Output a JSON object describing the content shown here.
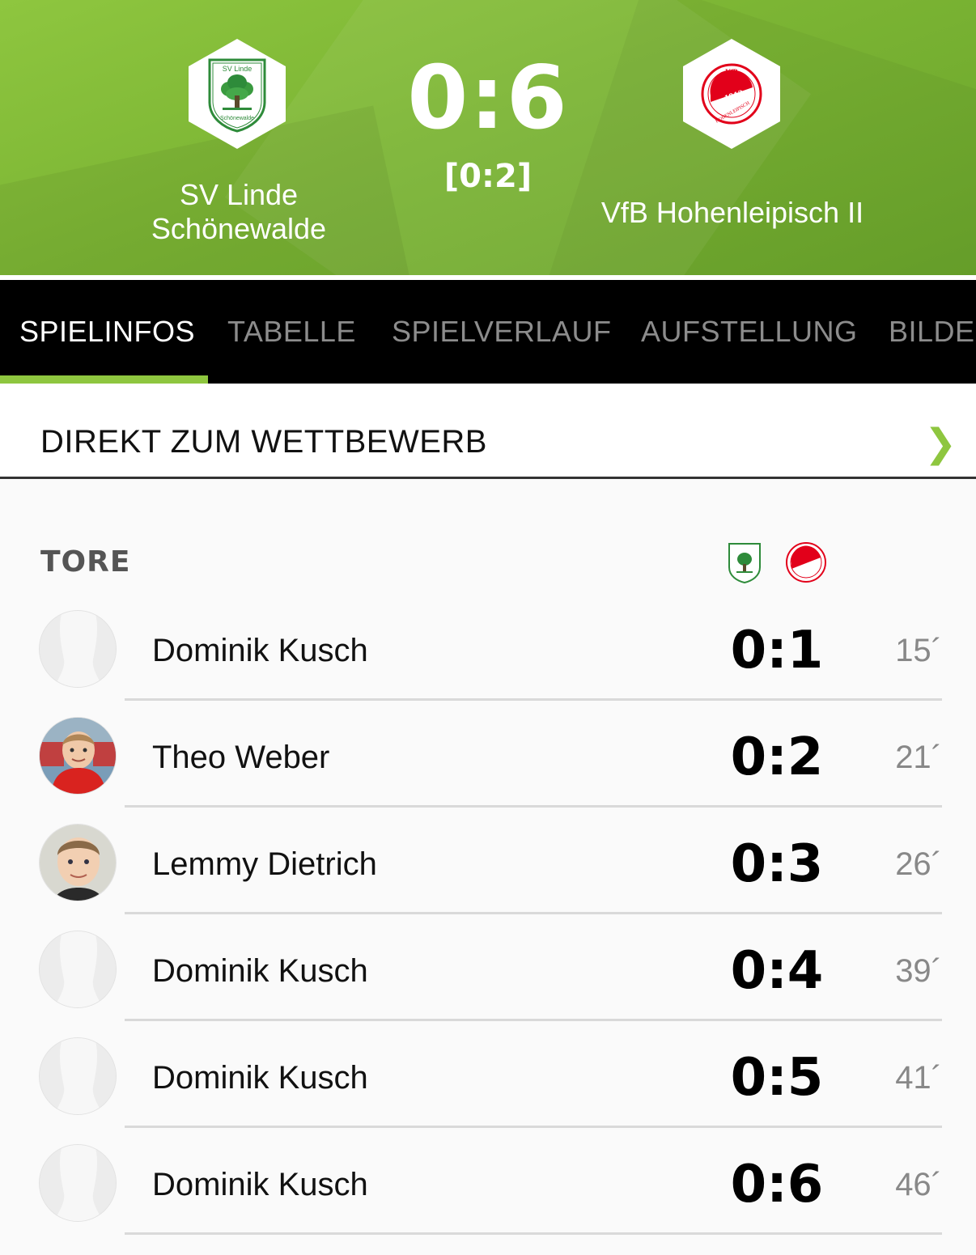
{
  "match": {
    "home_team": "SV Linde Schönewalde",
    "home_team_line1": "SV Linde",
    "home_team_line2": "Schönewalde",
    "away_team": "VfB Hohenleipisch II",
    "score": "0:6",
    "halftime_score": "[0:2]",
    "home_logo_text": "SV Linde",
    "home_logo_subtext": "Schönewalde",
    "away_logo_text": "VfB",
    "away_logo_year": "1912",
    "away_logo_subtext": "HOHENLEIPISCH"
  },
  "tabs": [
    {
      "label": "SPIELINFOS",
      "active": true
    },
    {
      "label": "TABELLE",
      "active": false
    },
    {
      "label": "SPIELVERLAUF",
      "active": false
    },
    {
      "label": "AUFSTELLUNG",
      "active": false
    },
    {
      "label": "BILDER",
      "active": false
    }
  ],
  "competition_link": {
    "label": "DIREKT ZUM WETTBEWERB",
    "icon": "chevron-right-icon"
  },
  "goals": {
    "title": "TORE",
    "rows": [
      {
        "player": "Dominik Kusch",
        "score": "0:1",
        "minute": "15´",
        "avatar": "placeholder"
      },
      {
        "player": "Theo Weber",
        "score": "0:2",
        "minute": "21´",
        "avatar": "photo-red-jersey"
      },
      {
        "player": "Lemmy Dietrich",
        "score": "0:3",
        "minute": "26´",
        "avatar": "photo-boy"
      },
      {
        "player": "Dominik Kusch",
        "score": "0:4",
        "minute": "39´",
        "avatar": "placeholder"
      },
      {
        "player": "Dominik Kusch",
        "score": "0:5",
        "minute": "41´",
        "avatar": "placeholder"
      },
      {
        "player": "Dominik Kusch",
        "score": "0:6",
        "minute": "46´",
        "avatar": "placeholder"
      }
    ]
  },
  "colors": {
    "accent": "#8ec63f",
    "tab_bar": "#000000",
    "away_red": "#e2001a"
  }
}
